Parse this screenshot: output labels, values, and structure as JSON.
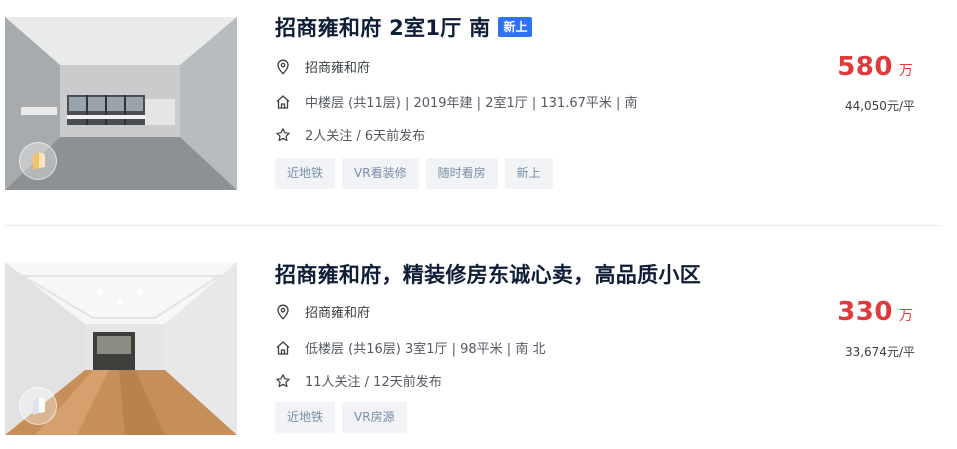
{
  "listings": [
    {
      "title": "招商雍和府 2室1厅 南",
      "tag_new": "新上",
      "location": "招商雍和府",
      "house_info": "中楼层 (共11层) | 2019年建 | 2室1厅 | 131.67平米 | 南",
      "follow_info": "2人关注 / 6天前发布",
      "tags": [
        "近地铁",
        "VR看装修",
        "随时看房",
        "新上"
      ],
      "total_price": "580",
      "price_unit": "万",
      "unit_price": "44,050元/平",
      "photo_icon": "vr-cube-icon"
    },
    {
      "title": "招商雍和府，精装修房东诚心卖，高品质小区",
      "location": "招商雍和府",
      "house_info": "低楼层 (共16层) 3室1厅 | 98平米 | 南 北",
      "follow_info": "11人关注 / 12天前发布",
      "tags": [
        "近地铁",
        "VR房源"
      ],
      "total_price": "330",
      "price_unit": "万",
      "unit_price": "33,674元/平",
      "photo_icon": "vr-cube-icon"
    }
  ],
  "colors": {
    "title": "#101d37",
    "price": "#e03a3a",
    "tag_new_bg": "#3072f6",
    "chip_bg": "#f1f3f7",
    "chip_text": "#7a8fa6"
  }
}
